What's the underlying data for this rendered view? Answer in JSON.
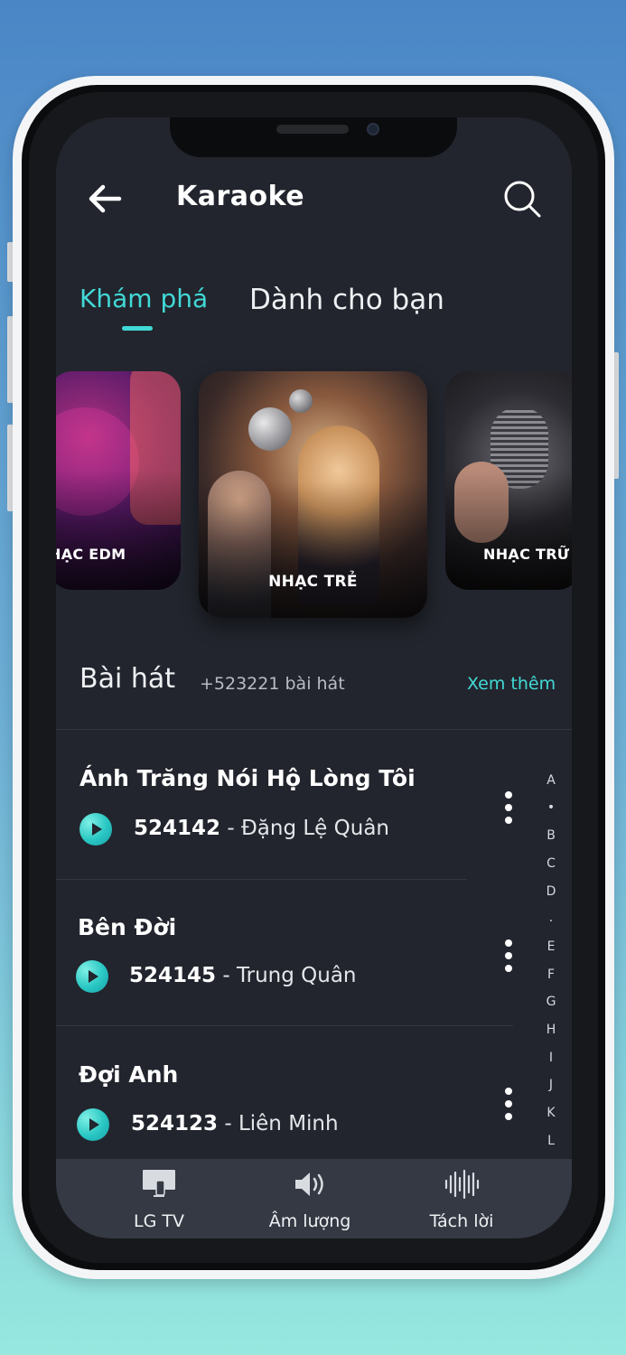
{
  "header": {
    "title": "Karaoke",
    "back_icon": "arrow-left-icon",
    "search_icon": "search-icon"
  },
  "tabs": [
    {
      "label": "Khám phá",
      "active": true
    },
    {
      "label": "Dành cho bạn",
      "active": false
    }
  ],
  "carousel": [
    {
      "label": "HẠC EDM"
    },
    {
      "label": "NHẠC TRẺ"
    },
    {
      "label": "NHẠC TRỮ"
    }
  ],
  "songs_section": {
    "title": "Bài hát",
    "count": "+523221 bài hát",
    "more": "Xem thêm"
  },
  "songs": [
    {
      "title": "Ánh Trăng Nói Hộ Lòng Tôi",
      "code": "524142",
      "sep": " - ",
      "artist": "Đặng Lệ Quân"
    },
    {
      "title": "Bên Đời",
      "code": "524145",
      "sep": " - ",
      "artist": "Trung Quân"
    },
    {
      "title": "Đợi Anh",
      "code": "524123",
      "sep": " - ",
      "artist": "Liên Minh"
    }
  ],
  "alphabet": [
    "A",
    "•",
    "B",
    "C",
    "D",
    ".",
    "E",
    "F",
    "G",
    "H",
    "I",
    "J",
    "K",
    "L"
  ],
  "bottom_bar": [
    {
      "label": "LG TV",
      "icon": "tv-icon"
    },
    {
      "label": "Âm lượng",
      "icon": "volume-icon"
    },
    {
      "label": "Tách lời",
      "icon": "waveform-icon"
    }
  ],
  "colors": {
    "accent": "#41d9d6",
    "background": "#22252d",
    "bottom_bar": "#343943"
  }
}
